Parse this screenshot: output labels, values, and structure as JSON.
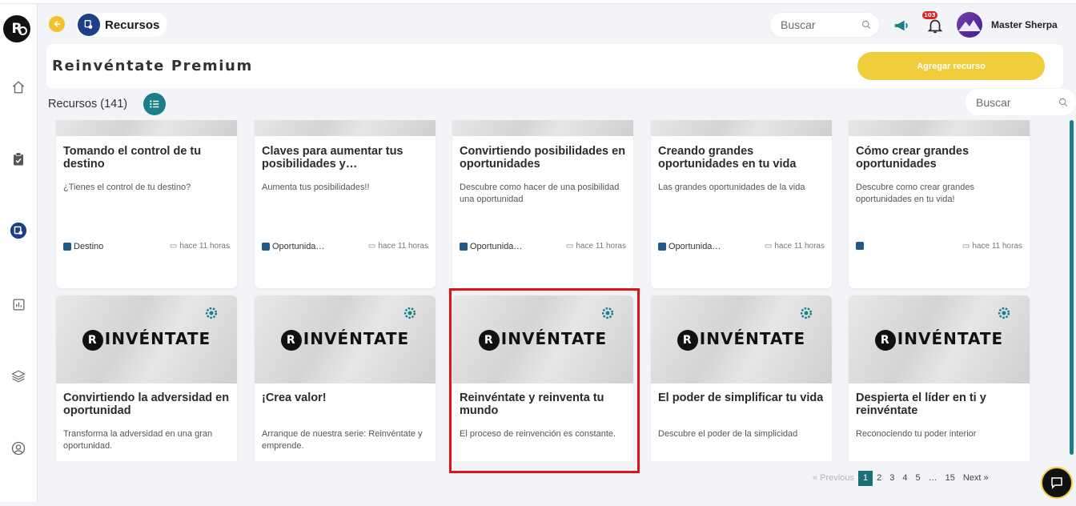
{
  "header": {
    "breadcrumb": "Recursos",
    "search_placeholder": "Buscar",
    "notification_count": "103",
    "user_name": "Master Sherpa"
  },
  "title_bar": {
    "title": "Reinvéntate Premium",
    "add_button": "Agregar recurso"
  },
  "list_header": {
    "count_label": "Recursos (141)",
    "search_placeholder": "Buscar"
  },
  "cards_row1": [
    {
      "title": "Tomando el control de tu destino",
      "desc": "¿Tienes el control de tu destino?",
      "tag": "Destino",
      "date": "hace 11 horas"
    },
    {
      "title": "Claves para aumentar tus posibilidades y…",
      "desc": "Aumenta tus posibilidades!!",
      "tag": "Oportunida…",
      "date": "hace 11 horas"
    },
    {
      "title": "Convirtiendo posibilidades en oportunidades",
      "desc": "Descubre como hacer de una posibilidad una oportunidad",
      "tag": "Oportunida…",
      "date": "hace 11 horas"
    },
    {
      "title": "Creando grandes oportunidades en tu vida",
      "desc": "Las grandes oportunidades de la vida",
      "tag": "Oportunida…",
      "date": "hace 11 horas"
    },
    {
      "title": "Cómo crear grandes oportunidades",
      "desc": "Descubre como crear grandes oportunidades en tu vida!",
      "tag": "",
      "date": "hace 11 horas"
    }
  ],
  "cards_row2": [
    {
      "brand": "INVÉNTATE",
      "title": "Convirtiendo la adversidad en oportunidad",
      "desc": "Transforma la adversidad en una gran oportunidad."
    },
    {
      "brand": "INVÉNTATE",
      "title": "¡Crea valor!",
      "desc": "Arranque de nuestra serie: Reinvéntate y emprende."
    },
    {
      "brand": "INVÉNTATE",
      "title": "Reinvéntate y reinventa tu mundo",
      "desc": "El proceso de reinvención es constante."
    },
    {
      "brand": "INVÉNTATE",
      "title": "El poder de simplificar tu vida",
      "desc": "Descubre el poder de la simplicidad"
    },
    {
      "brand": "INVÉNTATE",
      "title": "Despierta el líder en ti y reinvéntate",
      "desc": "Reconociendo tu poder interior"
    }
  ],
  "pagination": {
    "prev": "« Previous",
    "pages": [
      "1",
      "2",
      "3",
      "4",
      "5",
      "…",
      "15"
    ],
    "next": "Next »",
    "current": "1"
  },
  "colors": {
    "accent_yellow": "#f0cd3b",
    "accent_teal": "#1b7f89",
    "highlight_red": "#e0131a",
    "brand_blue": "#1f3e8a"
  }
}
